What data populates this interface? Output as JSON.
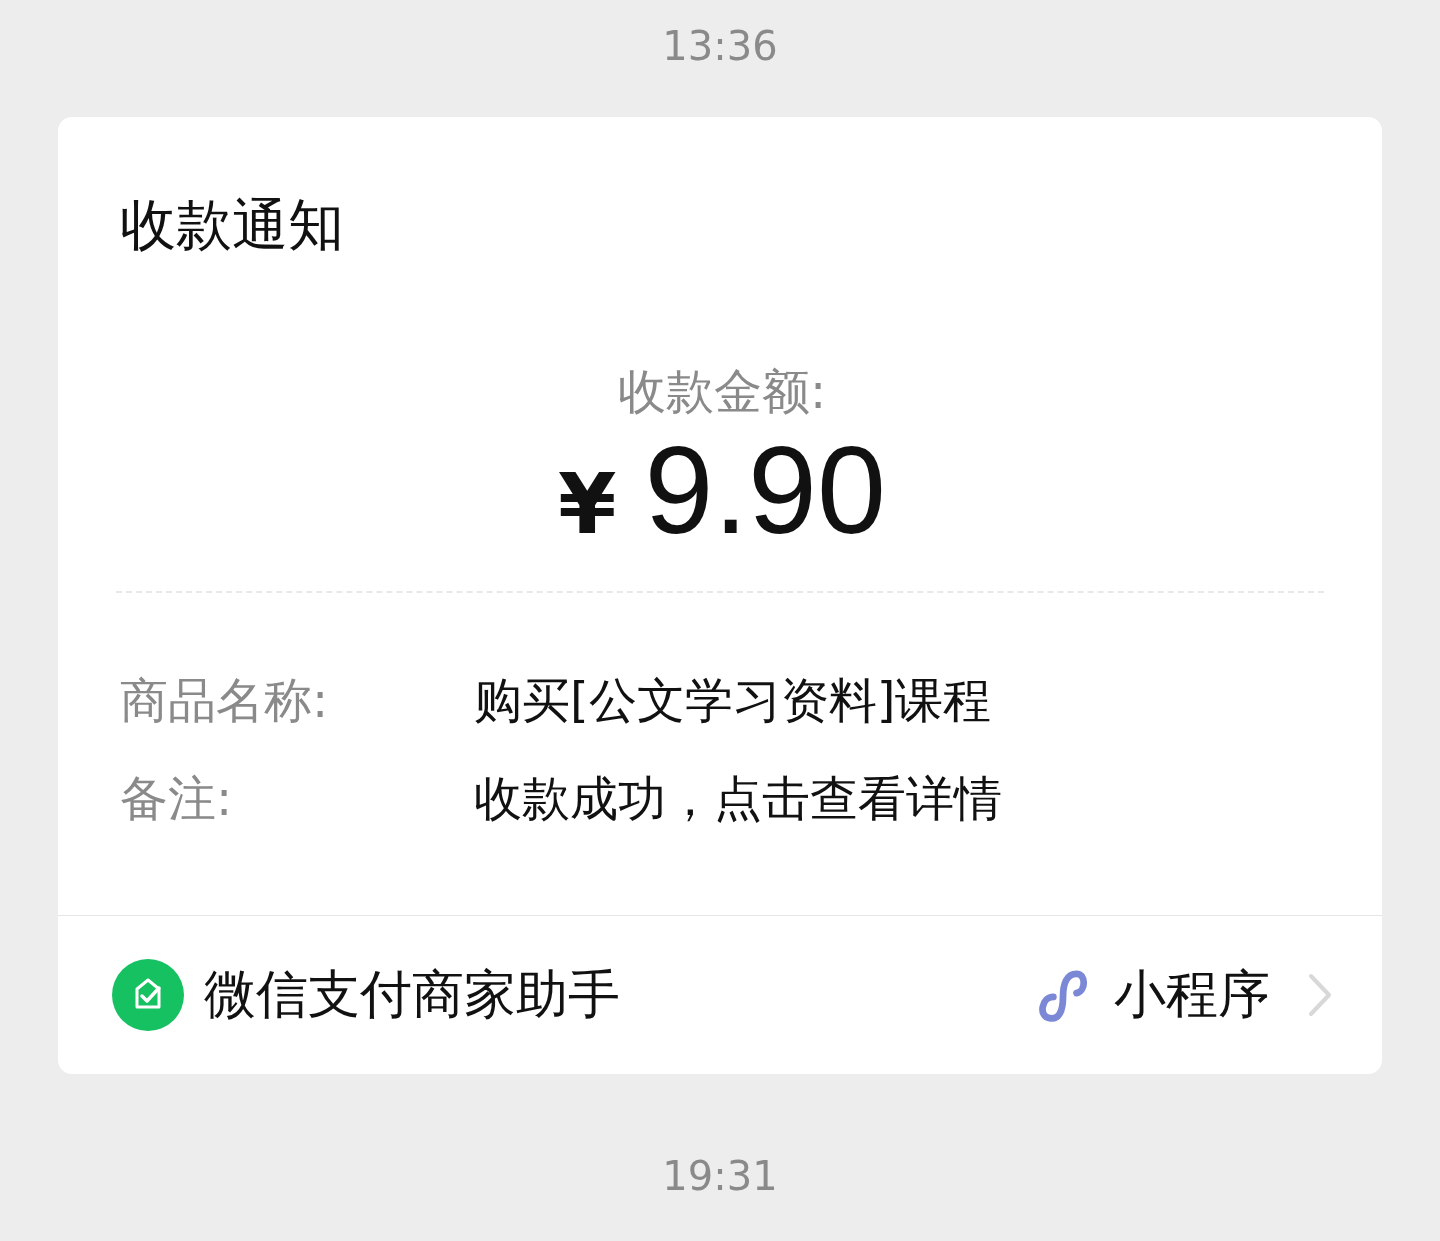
{
  "timestamps": [
    "13:36",
    "19:31"
  ],
  "card": {
    "title": "收款通知",
    "amount_label": "收款金额:",
    "currency": "¥",
    "amount": "9.90",
    "fields": [
      {
        "label": "商品名称:",
        "value": "购买[公文学习资料]课程"
      },
      {
        "label": "备注:",
        "value": "收款成功，点击查看详情"
      }
    ],
    "footer": {
      "source": "微信支付商家助手",
      "link": "小程序"
    }
  }
}
